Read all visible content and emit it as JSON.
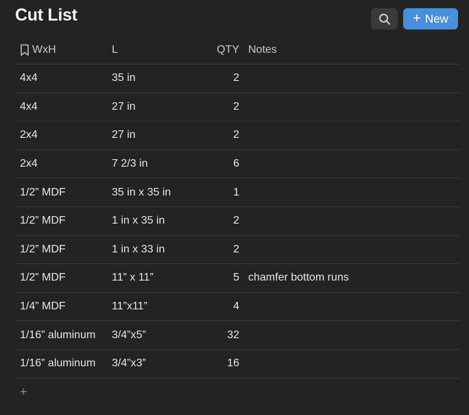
{
  "header": {
    "title": "Cut List",
    "new_label": "New"
  },
  "table": {
    "columns": {
      "wxh": "WxH",
      "l": "L",
      "qty": "QTY",
      "notes": "Notes"
    },
    "rows": [
      {
        "wxh": "4x4",
        "l": "35 in",
        "qty": "2",
        "notes": ""
      },
      {
        "wxh": "4x4",
        "l": "27 in",
        "qty": "2",
        "notes": ""
      },
      {
        "wxh": "2x4",
        "l": "27 in",
        "qty": "2",
        "notes": ""
      },
      {
        "wxh": "2x4",
        "l": "7 2/3 in",
        "qty": "6",
        "notes": ""
      },
      {
        "wxh": "1/2” MDF",
        "l": "35 in x 35 in",
        "qty": "1",
        "notes": ""
      },
      {
        "wxh": "1/2” MDF",
        "l": "1 in x 35 in",
        "qty": "2",
        "notes": ""
      },
      {
        "wxh": "1/2” MDF",
        "l": "1 in x 33 in",
        "qty": "2",
        "notes": ""
      },
      {
        "wxh": "1/2” MDF",
        "l": "11” x 11”",
        "qty": "5",
        "notes": "chamfer bottom runs"
      },
      {
        "wxh": "1/4” MDF",
        "l": "11”x11”",
        "qty": "4",
        "notes": ""
      },
      {
        "wxh": "1/16” aluminum",
        "l": "3/4”x5”",
        "qty": "32",
        "notes": ""
      },
      {
        "wxh": "1/16” aluminum",
        "l": "3/4”x3”",
        "qty": "16",
        "notes": ""
      }
    ],
    "add_row": "+"
  },
  "icons": {
    "search": "search-icon",
    "new": "plus-icon",
    "wxh_column": "bookmark-icon"
  },
  "colors": {
    "background": "#232323",
    "accent": "#4a8fd9",
    "divider": "#3a3a3a"
  }
}
